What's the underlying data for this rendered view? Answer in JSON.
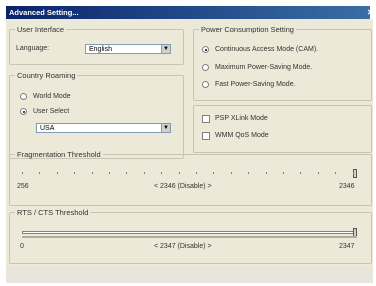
{
  "window": {
    "title": "Advanced Setting..."
  },
  "user_interface": {
    "title": "User Interface",
    "language_label": "Language:",
    "language_value": "English"
  },
  "country_roaming": {
    "title": "Country Roaming",
    "world_mode": "World Mode",
    "user_select": "User Select",
    "country_value": "USA",
    "selected": "user_select"
  },
  "power": {
    "title": "Power Consumption Setting",
    "options": [
      "Continuous Access Mode (CAM).",
      "Maximum Power-Saving Mode.",
      "Fast Power-Saving Mode."
    ],
    "selected_index": 0
  },
  "options": {
    "psp_xlink": "PSP XLink Mode",
    "wmm_qos": "WMM QoS Mode"
  },
  "fragmentation": {
    "title": "Fragmentation Threshold",
    "min": "256",
    "current": "< 2346 (Disable) >",
    "max": "2346",
    "value": 2346,
    "range": [
      256,
      2346
    ]
  },
  "rts": {
    "title": "RTS / CTS Threshold",
    "min": "0",
    "current": "< 2347 (Disable) >",
    "max": "2347",
    "value": 2347,
    "range": [
      0,
      2347
    ]
  }
}
